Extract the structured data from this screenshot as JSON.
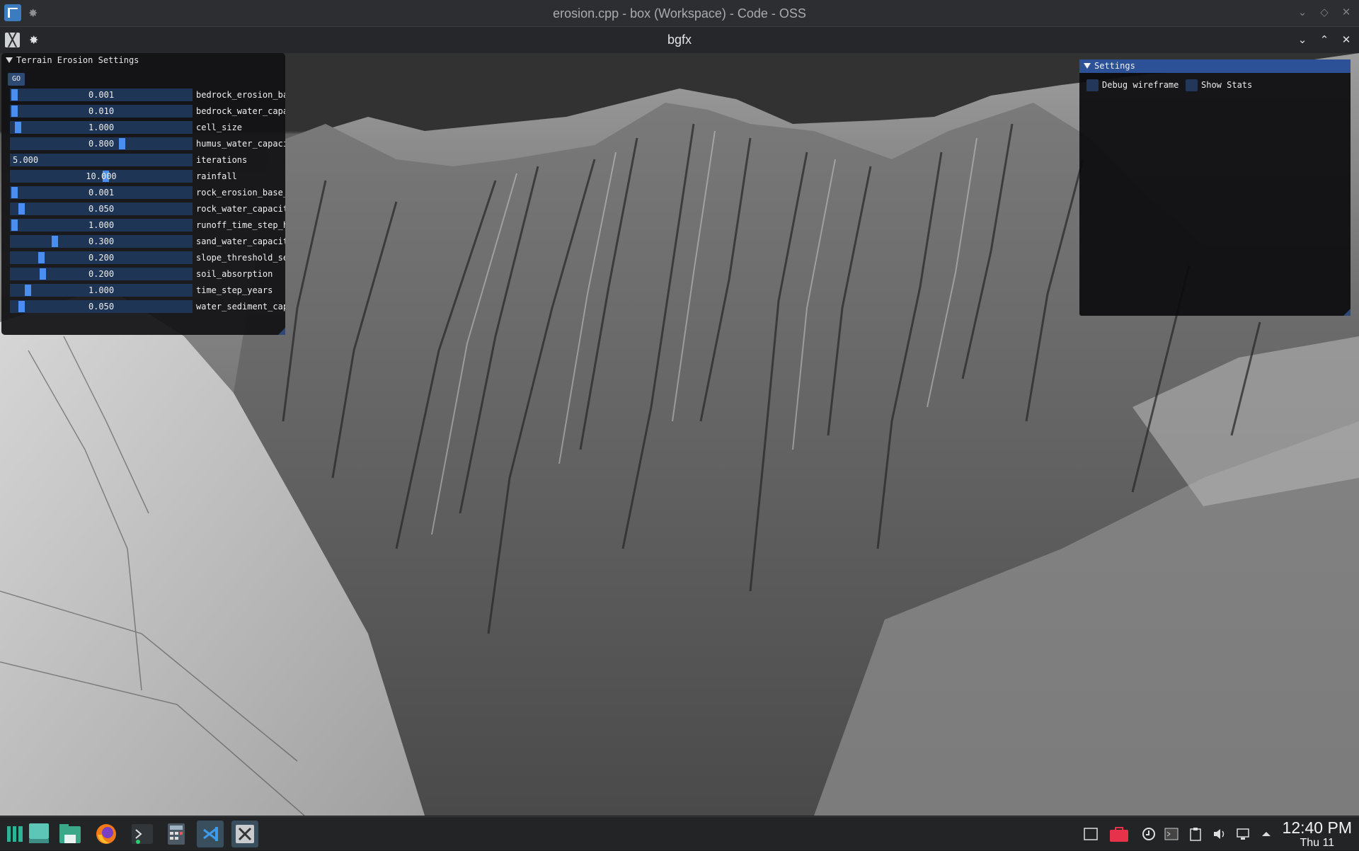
{
  "outer_window": {
    "title": "erosion.cpp - box (Workspace) - Code - OSS"
  },
  "inner_window": {
    "title": "bgfx"
  },
  "erosion_settings": {
    "title": "Terrain Erosion Settings",
    "go_label": "GO",
    "params": [
      {
        "label": "bedrock_erosion_ba",
        "value": "0.001",
        "level": 0.0
      },
      {
        "label": "bedrock_water_capa",
        "value": "0.010",
        "level": 0.0
      },
      {
        "label": "cell_size",
        "value": "1.000",
        "level": 0.02
      },
      {
        "label": "humus_water_capaci",
        "value": "0.800",
        "level": 0.64
      },
      {
        "label": "iterations",
        "value": "5.000",
        "level": null,
        "input": true
      },
      {
        "label": "rainfall",
        "value": "10.000",
        "level": 0.54
      },
      {
        "label": "rock_erosion_base_",
        "value": "0.001",
        "level": 0.0
      },
      {
        "label": "rock_water_capacit",
        "value": "0.050",
        "level": 0.04
      },
      {
        "label": "runoff_time_step_h",
        "value": "1.000",
        "level": 0.0
      },
      {
        "label": "sand_water_capacit",
        "value": "0.300",
        "level": 0.24
      },
      {
        "label": "slope_threshold_se",
        "value": "0.200",
        "level": 0.16
      },
      {
        "label": "soil_absorption",
        "value": "0.200",
        "level": 0.17
      },
      {
        "label": "time_step_years",
        "value": "1.000",
        "level": 0.08
      },
      {
        "label": "water_sediment_cap",
        "value": "0.050",
        "level": 0.04
      }
    ]
  },
  "settings_panel": {
    "title": "Settings",
    "debug_wireframe_label": "Debug wireframe",
    "show_stats_label": "Show Stats"
  },
  "taskbar": {
    "items": [
      "app-launcher-icon",
      "desktop-icon",
      "file-manager-icon",
      "firefox-icon",
      "terminal-icon",
      "calculator-icon",
      "vscode-icon",
      "bgfx-app-icon"
    ],
    "tray": [
      "window-icon",
      "briefcase-icon",
      "update-icon",
      "terminal-tray-icon",
      "clipboard-icon",
      "volume-icon",
      "network-icon",
      "expand-tray-icon"
    ],
    "time": "12:40 PM",
    "date": "Thu 11"
  }
}
